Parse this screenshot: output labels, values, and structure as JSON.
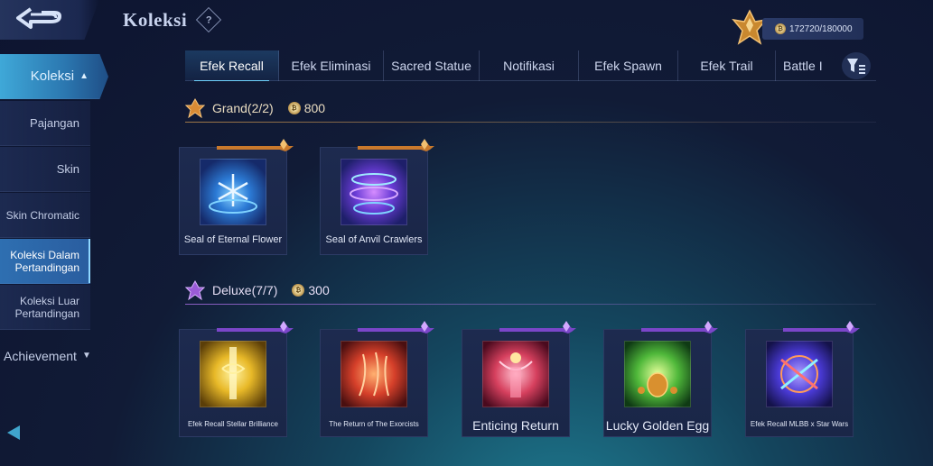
{
  "header": {
    "title": "Koleksi",
    "help_symbol": "?",
    "currency": "172720/180000",
    "icons": [
      "back-arrow-icon",
      "help-icon",
      "rank-emblem-icon",
      "coin-icon",
      "filter-icon"
    ]
  },
  "sidebar": {
    "koleksi": "Koleksi",
    "items": [
      "Pajangan",
      "Skin",
      "Skin Chromatic",
      "Koleksi Dalam Pertandingan",
      "Koleksi Luar Pertandingan"
    ],
    "achievement": "Achievement",
    "active_item": "Koleksi Dalam Pertandingan"
  },
  "tabs": [
    "Efek Recall",
    "Efek Eliminasi",
    "Sacred Statue",
    "Notifikasi",
    "Efek Spawn",
    "Efek Trail",
    "Battle I"
  ],
  "active_tab": "Efek Recall",
  "sections": {
    "grand": {
      "label": "Grand(2/2)",
      "cost": "800",
      "color": "#e0953c",
      "items": [
        "Seal of Eternal Flower",
        "Seal of Anvil Crawlers"
      ]
    },
    "deluxe": {
      "label": "Deluxe(7/7)",
      "cost": "300",
      "color": "#9a5bd6",
      "items": [
        "Efek Recall Stellar Brilliance",
        "The Return of The Exorcists",
        "Enticing Return",
        "Lucky Golden Egg",
        "Efek Recall MLBB x Star Wars"
      ]
    }
  }
}
